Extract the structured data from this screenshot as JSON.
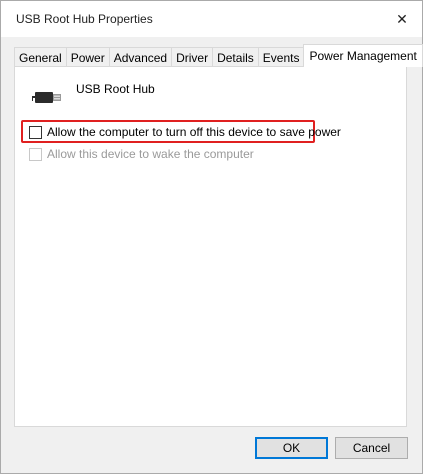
{
  "window": {
    "title": "USB Root Hub Properties",
    "close_glyph": "✕"
  },
  "tabs": [
    {
      "label": "General"
    },
    {
      "label": "Power"
    },
    {
      "label": "Advanced"
    },
    {
      "label": "Driver"
    },
    {
      "label": "Details"
    },
    {
      "label": "Events"
    },
    {
      "label": "Power Management",
      "active": true
    }
  ],
  "device": {
    "name": "USB Root Hub",
    "icon": "usb-plug-icon"
  },
  "options": [
    {
      "label": "Allow the computer to turn off this device to save power",
      "checked": false,
      "enabled": true,
      "highlighted": true,
      "highlight_color": "#e02020"
    },
    {
      "label": "Allow this device to wake the computer",
      "checked": false,
      "enabled": false
    }
  ],
  "buttons": {
    "ok": "OK",
    "cancel": "Cancel"
  }
}
